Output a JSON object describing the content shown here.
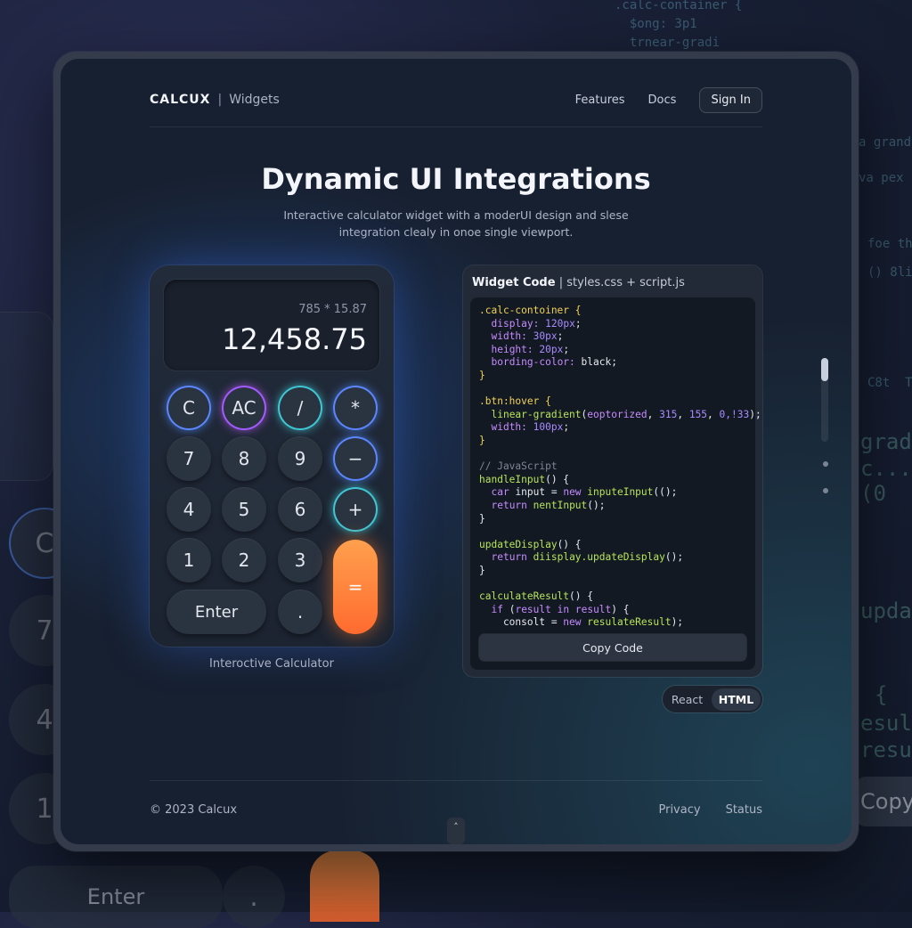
{
  "background": {
    "code_top": ".calc-container {\n  $ong: 3p1\n  trnear-gradi",
    "side_snippets": [
      "a grand(",
      "va pex b",
      "foe th",
      "() 8li",
      "C8t  T",
      "gradi",
      "c...(0",
      "updat",
      "{",
      "esult",
      "resul"
    ],
    "keys": [
      "C",
      "7",
      "4",
      "1"
    ],
    "enter": "Enter",
    "dot": ".",
    "equals": "=",
    "copy": "Copy"
  },
  "nav": {
    "brand": "CALCUX",
    "separator": "|",
    "sub": "Widgets",
    "links": [
      "Features",
      "Docs"
    ],
    "sign_in": "Sign In"
  },
  "hero": {
    "title": "Dynamic UI Integrations",
    "subtitle_line1": "Interactive calculator widget with a moderUI design and slese",
    "subtitle_line2": "integration clealy in onoe single viewport."
  },
  "calculator": {
    "expression": "785 * 15.87",
    "result": "12,458.75",
    "keys": {
      "clear": "C",
      "all_clear": "AC",
      "divide": "/",
      "multiply": "*",
      "seven": "7",
      "eight": "8",
      "nine": "9",
      "minus": "−",
      "four": "4",
      "five": "5",
      "six": "6",
      "plus": "+",
      "one": "1",
      "two": "2",
      "three": "3",
      "equals": "=",
      "enter": "Enter",
      "decimal": "."
    },
    "caption": "Interoctive Calculator"
  },
  "code_panel": {
    "title_bold": "Widget Code",
    "title_rest": " | styles.css + script.js",
    "copy_label": "Copy Code"
  },
  "toggle": {
    "react": "React",
    "html": "HTML",
    "selected": "HTML"
  },
  "footer": {
    "copyright": "© 2023 Calcux",
    "links": [
      "Privacy",
      "Status"
    ],
    "up_glyph": "˄"
  },
  "colors": {
    "accent_orange": "#ff7a34",
    "accent_blue": "#5b86ff",
    "accent_purple": "#a35bff",
    "accent_teal": "#3fc6d4"
  }
}
